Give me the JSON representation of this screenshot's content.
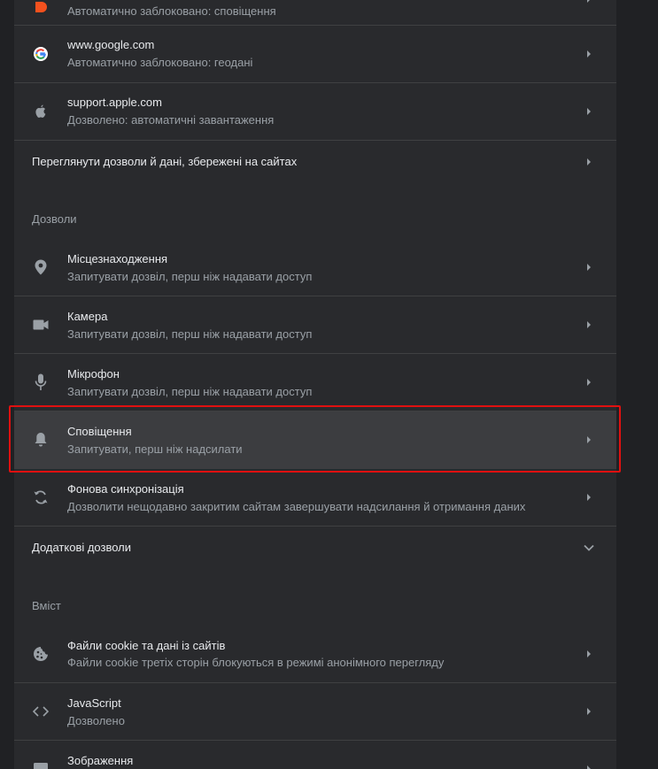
{
  "recent_sites": [
    {
      "site": "",
      "status": "Автоматично заблоковано: сповіщення",
      "icon": "site-orange-favicon"
    },
    {
      "site": "www.google.com",
      "status": "Автоматично заблоковано: геодані",
      "icon": "google-icon"
    },
    {
      "site": "support.apple.com",
      "status": "Дозволено: автоматичні завантаження",
      "icon": "apple-icon"
    }
  ],
  "view_permissions_link": "Переглянути дозволи й дані, збережені на сайтах",
  "permissions": {
    "header": "Дозволи",
    "items": [
      {
        "title": "Місцезнаходження",
        "subtitle": "Запитувати дозвіл, перш ніж надавати доступ",
        "icon": "location-pin-icon"
      },
      {
        "title": "Камера",
        "subtitle": "Запитувати дозвіл, перш ніж надавати доступ",
        "icon": "camera-icon"
      },
      {
        "title": "Мікрофон",
        "subtitle": "Запитувати дозвіл, перш ніж надавати доступ",
        "icon": "microphone-icon"
      },
      {
        "title": "Сповіщення",
        "subtitle": "Запитувати, перш ніж надсилати",
        "icon": "bell-icon"
      },
      {
        "title": "Фонова синхронізація",
        "subtitle": "Дозволити нещодавно закритим сайтам завершувати надсилання й отримання даних",
        "icon": "sync-icon"
      }
    ],
    "additional": "Додаткові дозволи"
  },
  "content": {
    "header": "Вміст",
    "items": [
      {
        "title": "Файли cookie та дані із сайтів",
        "subtitle": "Файли cookie третіх сторін блокуються в режимі анонімного перегляду",
        "icon": "cookie-icon"
      },
      {
        "title": "JavaScript",
        "subtitle": "Дозволено",
        "icon": "code-icon"
      },
      {
        "title": "Зображення",
        "subtitle": "",
        "icon": "image-icon"
      }
    ]
  },
  "colors": {
    "background": "#202124",
    "card": "#292a2d",
    "highlight_row": "#3c3d40",
    "highlight_border": "#e01010",
    "text_primary": "#e8eaed",
    "text_secondary": "#9aa0a6"
  }
}
